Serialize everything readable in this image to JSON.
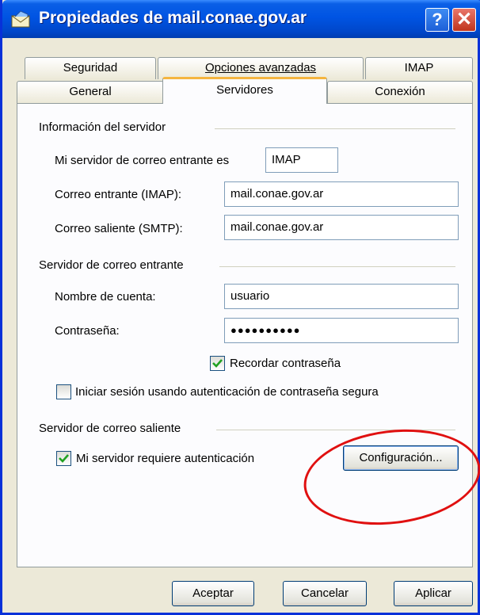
{
  "window": {
    "title": "Propiedades de mail.conae.gov.ar",
    "help_glyph": "?",
    "close_glyph": "✕"
  },
  "tabs": {
    "row1": [
      {
        "label": "Seguridad"
      },
      {
        "label": "Opciones avanzadas"
      },
      {
        "label": "IMAP"
      }
    ],
    "row2": [
      {
        "label": "General"
      },
      {
        "label": "Servidores"
      },
      {
        "label": "Conexión"
      }
    ],
    "active": "Servidores"
  },
  "server_info": {
    "group_label": "Información del servidor",
    "incoming_type_label": "Mi servidor de correo entrante es",
    "incoming_type_value": "IMAP",
    "incoming_label": "Correo entrante (IMAP):",
    "incoming_value": "mail.conae.gov.ar",
    "outgoing_label": "Correo saliente (SMTP):",
    "outgoing_value": "mail.conae.gov.ar"
  },
  "incoming_server": {
    "group_label": "Servidor de correo entrante",
    "account_label": "Nombre de cuenta:",
    "account_value": "usuario",
    "password_label": "Contraseña:",
    "password_value": "●●●●●●●●●●",
    "remember_label": "Recordar contraseña",
    "remember_checked": true,
    "spa_label": "Iniciar sesión usando autenticación de contraseña segura",
    "spa_checked": false
  },
  "outgoing_server": {
    "group_label": "Servidor de correo saliente",
    "auth_label": "Mi servidor requiere autenticación",
    "auth_checked": true,
    "settings_button": "Configuración..."
  },
  "buttons": {
    "ok": "Aceptar",
    "cancel": "Cancelar",
    "apply": "Aplicar"
  },
  "colors": {
    "titlebar": "#0054e3",
    "dialog_bg": "#ece9d8",
    "active_tab_highlight": "#f5b53f",
    "annotation": "#e01010"
  }
}
